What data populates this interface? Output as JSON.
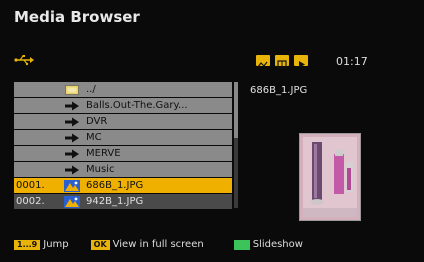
{
  "header": {
    "title": "Media Browser"
  },
  "status": {
    "time": "01:17"
  },
  "mode_icons": [
    "photo-mode-icon",
    "music-mode-icon",
    "video-mode-icon"
  ],
  "list": {
    "rows": [
      {
        "num": "",
        "icon": "folder-icon",
        "label": "../",
        "style": "normal"
      },
      {
        "num": "",
        "icon": "arrow-icon",
        "label": "Balls.Out-The.Gary...",
        "style": "normal"
      },
      {
        "num": "",
        "icon": "arrow-icon",
        "label": "DVR",
        "style": "normal"
      },
      {
        "num": "",
        "icon": "arrow-icon",
        "label": "MC",
        "style": "normal"
      },
      {
        "num": "",
        "icon": "arrow-icon",
        "label": "MERVE",
        "style": "normal"
      },
      {
        "num": "",
        "icon": "arrow-icon",
        "label": "Music",
        "style": "normal"
      },
      {
        "num": "0001.",
        "icon": "image-icon",
        "label": "686B_1.JPG",
        "style": "sel"
      },
      {
        "num": "0002.",
        "icon": "image-icon",
        "label": "942B_1.JPG",
        "style": "dark"
      }
    ]
  },
  "preview": {
    "filename": "686B_1.JPG"
  },
  "footer": {
    "jump_key": "1...9",
    "jump_label": "Jump",
    "ok_key": "OK",
    "ok_label": "View in full screen",
    "slideshow_label": "Slideshow"
  },
  "colors": {
    "accent": "#f0b000",
    "row_bg": "#8a8a8a",
    "dark_row_bg": "#4a4a4a",
    "green": "#3cc35a"
  }
}
